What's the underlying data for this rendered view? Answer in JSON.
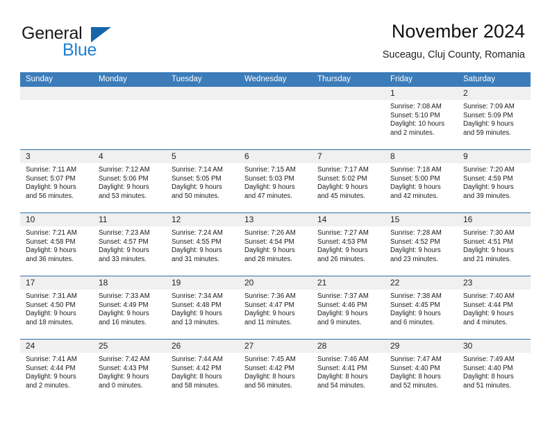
{
  "brand": {
    "name_part1": "General",
    "name_part2": "Blue",
    "triangle_color": "#1565a8",
    "blue_text_color": "#1f7fd0"
  },
  "header": {
    "title": "November 2024",
    "subtitle": "Suceagu, Cluj County, Romania"
  },
  "theme": {
    "header_row_bg": "#3b7cb9",
    "day_head_bg": "#f0f0f0",
    "grid_line": "#2e6da4"
  },
  "calendar": {
    "weekday_headers": [
      "Sunday",
      "Monday",
      "Tuesday",
      "Wednesday",
      "Thursday",
      "Friday",
      "Saturday"
    ],
    "weeks": [
      [
        {
          "date": "",
          "empty": true
        },
        {
          "date": "",
          "empty": true
        },
        {
          "date": "",
          "empty": true
        },
        {
          "date": "",
          "empty": true
        },
        {
          "date": "",
          "empty": true
        },
        {
          "date": "1",
          "sunrise": "Sunrise: 7:08 AM",
          "sunset": "Sunset: 5:10 PM",
          "daylight": "Daylight: 10 hours and 2 minutes."
        },
        {
          "date": "2",
          "sunrise": "Sunrise: 7:09 AM",
          "sunset": "Sunset: 5:09 PM",
          "daylight": "Daylight: 9 hours and 59 minutes."
        }
      ],
      [
        {
          "date": "3",
          "sunrise": "Sunrise: 7:11 AM",
          "sunset": "Sunset: 5:07 PM",
          "daylight": "Daylight: 9 hours and 56 minutes."
        },
        {
          "date": "4",
          "sunrise": "Sunrise: 7:12 AM",
          "sunset": "Sunset: 5:06 PM",
          "daylight": "Daylight: 9 hours and 53 minutes."
        },
        {
          "date": "5",
          "sunrise": "Sunrise: 7:14 AM",
          "sunset": "Sunset: 5:05 PM",
          "daylight": "Daylight: 9 hours and 50 minutes."
        },
        {
          "date": "6",
          "sunrise": "Sunrise: 7:15 AM",
          "sunset": "Sunset: 5:03 PM",
          "daylight": "Daylight: 9 hours and 47 minutes."
        },
        {
          "date": "7",
          "sunrise": "Sunrise: 7:17 AM",
          "sunset": "Sunset: 5:02 PM",
          "daylight": "Daylight: 9 hours and 45 minutes."
        },
        {
          "date": "8",
          "sunrise": "Sunrise: 7:18 AM",
          "sunset": "Sunset: 5:00 PM",
          "daylight": "Daylight: 9 hours and 42 minutes."
        },
        {
          "date": "9",
          "sunrise": "Sunrise: 7:20 AM",
          "sunset": "Sunset: 4:59 PM",
          "daylight": "Daylight: 9 hours and 39 minutes."
        }
      ],
      [
        {
          "date": "10",
          "sunrise": "Sunrise: 7:21 AM",
          "sunset": "Sunset: 4:58 PM",
          "daylight": "Daylight: 9 hours and 36 minutes."
        },
        {
          "date": "11",
          "sunrise": "Sunrise: 7:23 AM",
          "sunset": "Sunset: 4:57 PM",
          "daylight": "Daylight: 9 hours and 33 minutes."
        },
        {
          "date": "12",
          "sunrise": "Sunrise: 7:24 AM",
          "sunset": "Sunset: 4:55 PM",
          "daylight": "Daylight: 9 hours and 31 minutes."
        },
        {
          "date": "13",
          "sunrise": "Sunrise: 7:26 AM",
          "sunset": "Sunset: 4:54 PM",
          "daylight": "Daylight: 9 hours and 28 minutes."
        },
        {
          "date": "14",
          "sunrise": "Sunrise: 7:27 AM",
          "sunset": "Sunset: 4:53 PM",
          "daylight": "Daylight: 9 hours and 26 minutes."
        },
        {
          "date": "15",
          "sunrise": "Sunrise: 7:28 AM",
          "sunset": "Sunset: 4:52 PM",
          "daylight": "Daylight: 9 hours and 23 minutes."
        },
        {
          "date": "16",
          "sunrise": "Sunrise: 7:30 AM",
          "sunset": "Sunset: 4:51 PM",
          "daylight": "Daylight: 9 hours and 21 minutes."
        }
      ],
      [
        {
          "date": "17",
          "sunrise": "Sunrise: 7:31 AM",
          "sunset": "Sunset: 4:50 PM",
          "daylight": "Daylight: 9 hours and 18 minutes."
        },
        {
          "date": "18",
          "sunrise": "Sunrise: 7:33 AM",
          "sunset": "Sunset: 4:49 PM",
          "daylight": "Daylight: 9 hours and 16 minutes."
        },
        {
          "date": "19",
          "sunrise": "Sunrise: 7:34 AM",
          "sunset": "Sunset: 4:48 PM",
          "daylight": "Daylight: 9 hours and 13 minutes."
        },
        {
          "date": "20",
          "sunrise": "Sunrise: 7:36 AM",
          "sunset": "Sunset: 4:47 PM",
          "daylight": "Daylight: 9 hours and 11 minutes."
        },
        {
          "date": "21",
          "sunrise": "Sunrise: 7:37 AM",
          "sunset": "Sunset: 4:46 PM",
          "daylight": "Daylight: 9 hours and 9 minutes."
        },
        {
          "date": "22",
          "sunrise": "Sunrise: 7:38 AM",
          "sunset": "Sunset: 4:45 PM",
          "daylight": "Daylight: 9 hours and 6 minutes."
        },
        {
          "date": "23",
          "sunrise": "Sunrise: 7:40 AM",
          "sunset": "Sunset: 4:44 PM",
          "daylight": "Daylight: 9 hours and 4 minutes."
        }
      ],
      [
        {
          "date": "24",
          "sunrise": "Sunrise: 7:41 AM",
          "sunset": "Sunset: 4:44 PM",
          "daylight": "Daylight: 9 hours and 2 minutes."
        },
        {
          "date": "25",
          "sunrise": "Sunrise: 7:42 AM",
          "sunset": "Sunset: 4:43 PM",
          "daylight": "Daylight: 9 hours and 0 minutes."
        },
        {
          "date": "26",
          "sunrise": "Sunrise: 7:44 AM",
          "sunset": "Sunset: 4:42 PM",
          "daylight": "Daylight: 8 hours and 58 minutes."
        },
        {
          "date": "27",
          "sunrise": "Sunrise: 7:45 AM",
          "sunset": "Sunset: 4:42 PM",
          "daylight": "Daylight: 8 hours and 56 minutes."
        },
        {
          "date": "28",
          "sunrise": "Sunrise: 7:46 AM",
          "sunset": "Sunset: 4:41 PM",
          "daylight": "Daylight: 8 hours and 54 minutes."
        },
        {
          "date": "29",
          "sunrise": "Sunrise: 7:47 AM",
          "sunset": "Sunset: 4:40 PM",
          "daylight": "Daylight: 8 hours and 52 minutes."
        },
        {
          "date": "30",
          "sunrise": "Sunrise: 7:49 AM",
          "sunset": "Sunset: 4:40 PM",
          "daylight": "Daylight: 8 hours and 51 minutes."
        }
      ]
    ]
  }
}
